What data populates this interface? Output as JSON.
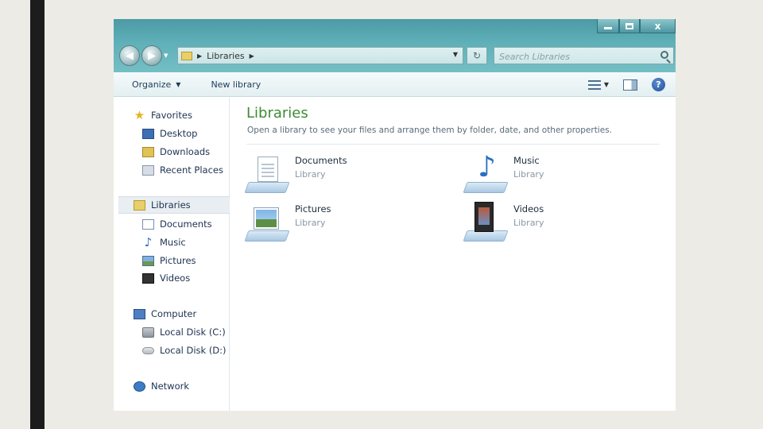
{
  "window": {
    "close_label": "x"
  },
  "address_bar": {
    "path": [
      "Libraries"
    ],
    "search_placeholder": "Search Libraries"
  },
  "toolbar": {
    "organize_label": "Organize",
    "new_library_label": "New library"
  },
  "nav": {
    "favorites": {
      "label": "Favorites",
      "items": [
        {
          "label": "Desktop"
        },
        {
          "label": "Downloads"
        },
        {
          "label": "Recent Places"
        }
      ]
    },
    "libraries": {
      "label": "Libraries",
      "items": [
        {
          "label": "Documents"
        },
        {
          "label": "Music"
        },
        {
          "label": "Pictures"
        },
        {
          "label": "Videos"
        }
      ]
    },
    "computer": {
      "label": "Computer",
      "items": [
        {
          "label": "Local Disk (C:)"
        },
        {
          "label": "Local Disk (D:)"
        }
      ]
    },
    "network": {
      "label": "Network"
    }
  },
  "content": {
    "title": "Libraries",
    "subtitle": "Open a library to see your files and arrange them by folder, date, and other properties.",
    "libraries": [
      {
        "name": "Documents",
        "type": "Library"
      },
      {
        "name": "Music",
        "type": "Library"
      },
      {
        "name": "Pictures",
        "type": "Library"
      },
      {
        "name": "Videos",
        "type": "Library"
      }
    ]
  },
  "colors": {
    "title_green": "#3d8b33",
    "chrome_teal": "#5fb0b8"
  }
}
